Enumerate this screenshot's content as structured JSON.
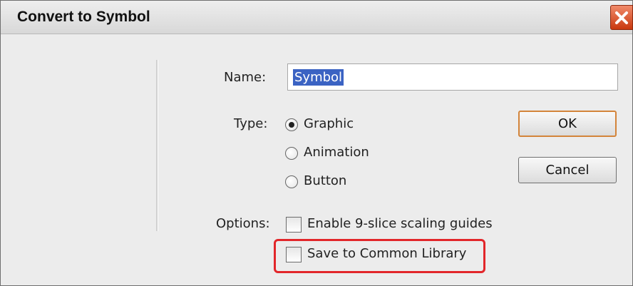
{
  "window": {
    "title": "Convert to Symbol",
    "close_icon": "close-icon"
  },
  "form": {
    "name_label": "Name:",
    "name_value": "Symbol",
    "type_label": "Type:",
    "type_options": [
      "Graphic",
      "Animation",
      "Button"
    ],
    "type_selected": "Graphic",
    "options_label": "Options:",
    "checkbox_slice": "Enable 9-slice scaling guides",
    "checkbox_slice_checked": false,
    "checkbox_library": "Save to Common Library",
    "checkbox_library_checked": false
  },
  "buttons": {
    "ok": "OK",
    "cancel": "Cancel"
  },
  "colors": {
    "selection": "#3b63c3",
    "highlight_box": "#e2262a",
    "close_button": "#d9532e"
  }
}
